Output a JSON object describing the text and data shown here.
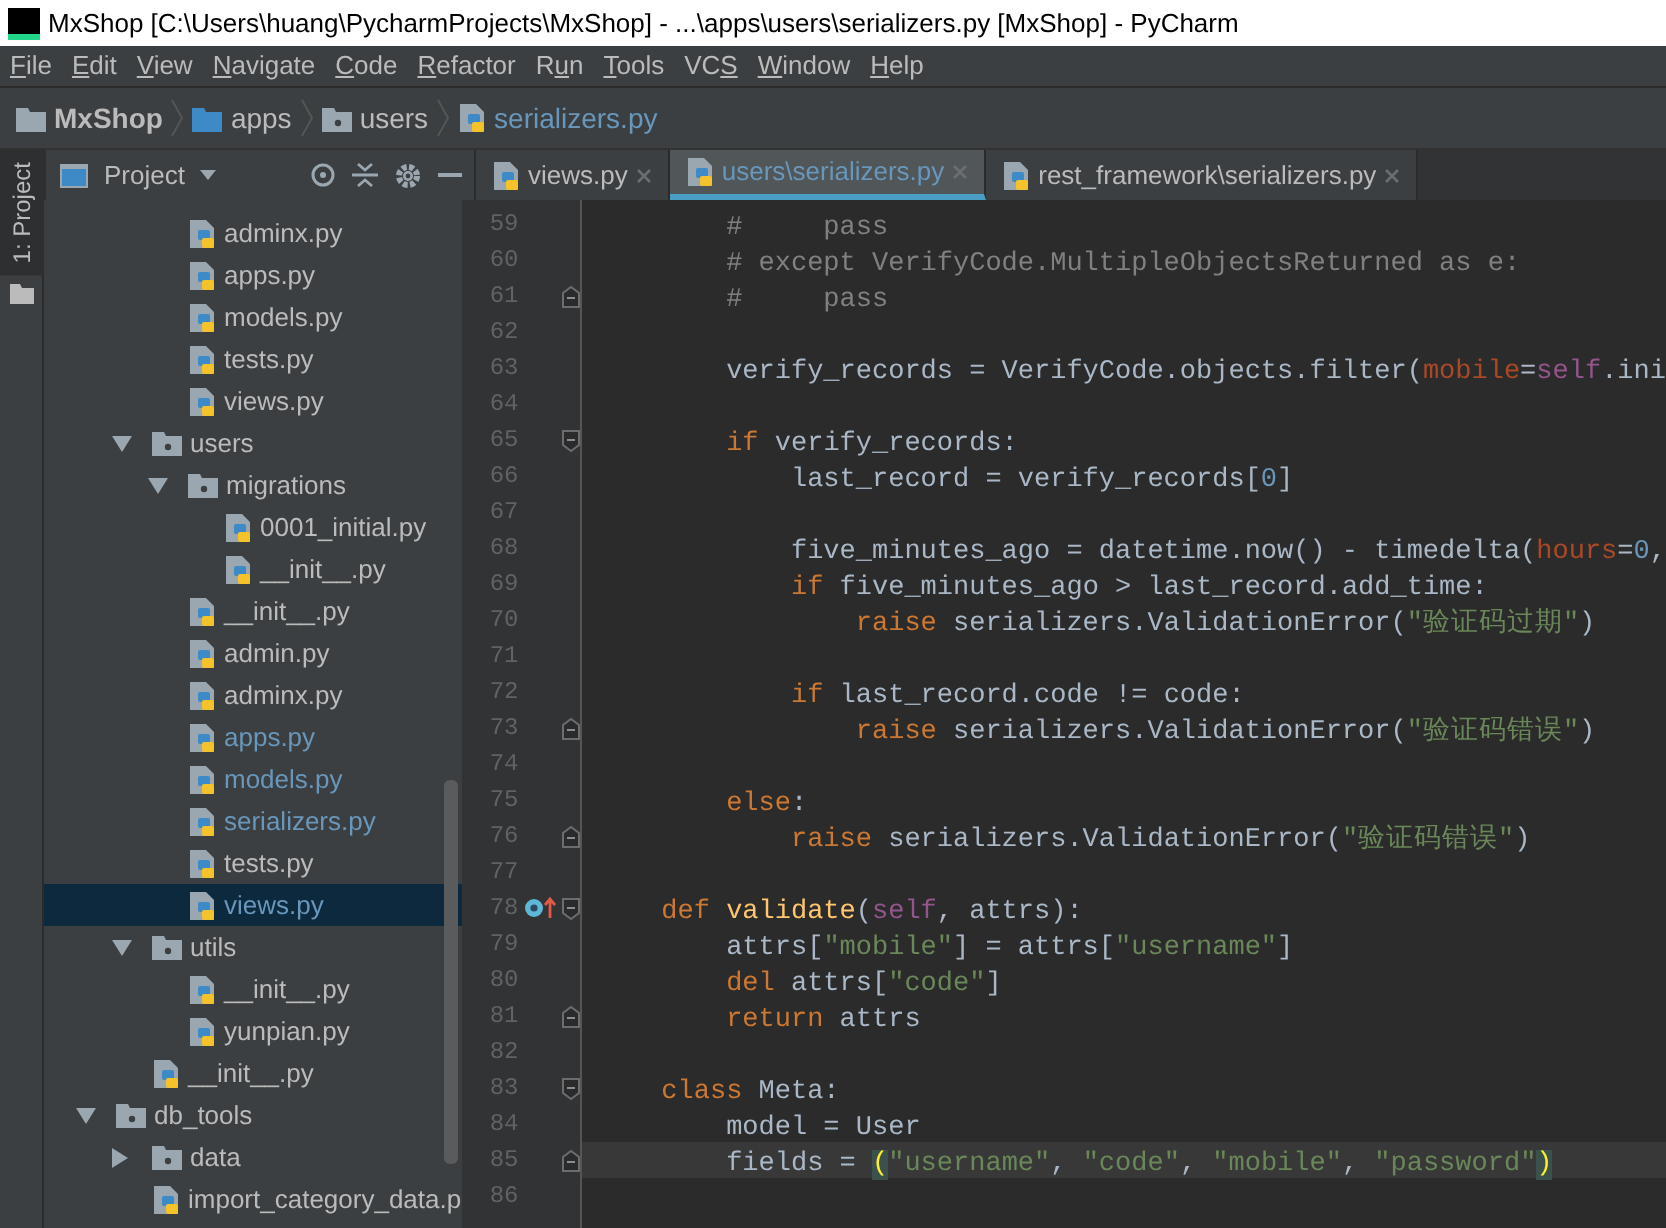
{
  "window": {
    "title": "MxShop [C:\\Users\\huang\\PycharmProjects\\MxShop] - ...\\apps\\users\\serializers.py [MxShop] - PyCharm"
  },
  "menu": [
    {
      "key": "F",
      "post": "ile"
    },
    {
      "key": "E",
      "post": "dit"
    },
    {
      "key": "V",
      "post": "iew"
    },
    {
      "key": "N",
      "post": "avigate"
    },
    {
      "key": "C",
      "post": "ode"
    },
    {
      "key": "R",
      "post": "efactor"
    },
    {
      "pre": "R",
      "key": "u",
      "post": "n"
    },
    {
      "key": "T",
      "post": "ools"
    },
    {
      "pre": "VC",
      "key": "S"
    },
    {
      "key": "W",
      "post": "indow"
    },
    {
      "key": "H",
      "post": "elp"
    }
  ],
  "breadcrumb": [
    {
      "label": "MxShop",
      "kind": "project"
    },
    {
      "label": "apps",
      "kind": "source-folder"
    },
    {
      "label": "users",
      "kind": "package"
    },
    {
      "label": "serializers.py",
      "kind": "file"
    }
  ],
  "side_stripe": {
    "label": "1: Project",
    "selected": true
  },
  "project_panel": {
    "title": "Project"
  },
  "tree": [
    {
      "kind": "continuation",
      "children": [
        {
          "kind": "continuation",
          "children": [
            {
              "kind": "file",
              "label": "adminx.py",
              "modified": false,
              "selected": false
            },
            {
              "kind": "file",
              "label": "apps.py",
              "modified": false,
              "selected": false
            },
            {
              "kind": "file",
              "label": "models.py",
              "modified": false,
              "selected": false
            },
            {
              "kind": "file",
              "label": "tests.py",
              "modified": false,
              "selected": false
            },
            {
              "kind": "file",
              "label": "views.py",
              "modified": false,
              "selected": false
            }
          ]
        },
        {
          "kind": "folder",
          "label": "users",
          "expanded": true,
          "children": [
            {
              "kind": "folder",
              "label": "migrations",
              "expanded": true,
              "children": [
                {
                  "kind": "file",
                  "label": "0001_initial.py",
                  "modified": false,
                  "selected": false
                },
                {
                  "kind": "file",
                  "label": "__init__.py",
                  "modified": false,
                  "selected": false
                }
              ]
            },
            {
              "kind": "file",
              "label": "__init__.py",
              "modified": false,
              "selected": false
            },
            {
              "kind": "file",
              "label": "admin.py",
              "modified": false,
              "selected": false
            },
            {
              "kind": "file",
              "label": "adminx.py",
              "modified": false,
              "selected": false
            },
            {
              "kind": "file",
              "label": "apps.py",
              "modified": true,
              "selected": false
            },
            {
              "kind": "file",
              "label": "models.py",
              "modified": true,
              "selected": false
            },
            {
              "kind": "file",
              "label": "serializers.py",
              "modified": true,
              "selected": false
            },
            {
              "kind": "file",
              "label": "tests.py",
              "modified": false,
              "selected": false
            },
            {
              "kind": "file",
              "label": "views.py",
              "modified": true,
              "selected": true
            }
          ]
        },
        {
          "kind": "folder",
          "label": "utils",
          "expanded": true,
          "children": [
            {
              "kind": "file",
              "label": "__init__.py",
              "modified": false,
              "selected": false
            },
            {
              "kind": "file",
              "label": "yunpian.py",
              "modified": false,
              "selected": false
            }
          ]
        },
        {
          "kind": "file",
          "label": "__init__.py",
          "modified": false,
          "selected": false
        }
      ]
    },
    {
      "kind": "folder",
      "label": "db_tools",
      "expanded": true,
      "children": [
        {
          "kind": "folder",
          "label": "data",
          "expanded": false
        },
        {
          "kind": "file",
          "label": "import_category_data.p",
          "modified": false,
          "selected": false
        }
      ]
    }
  ],
  "editor_tabs": [
    {
      "label": "views.py",
      "modified": false,
      "selected": false
    },
    {
      "label": "users\\serializers.py",
      "modified": true,
      "selected": true
    },
    {
      "label": "rest_framework\\serializers.py",
      "modified": false,
      "selected": false
    }
  ],
  "code_lines": [
    {
      "number": "59",
      "fold_start": false,
      "fold_end": false,
      "override": false,
      "current": false,
      "tokens": [
        {
          "kind": "comment",
          "text": "        #     pass"
        }
      ]
    },
    {
      "number": "60",
      "fold_start": false,
      "fold_end": false,
      "override": false,
      "current": false,
      "tokens": [
        {
          "kind": "comment",
          "text": "        # except VerifyCode.MultipleObjectsReturned as e:"
        }
      ]
    },
    {
      "number": "61",
      "fold_start": false,
      "fold_end": true,
      "override": false,
      "current": false,
      "tokens": [
        {
          "kind": "comment",
          "text": "        #     pass"
        }
      ]
    },
    {
      "number": "62",
      "fold_start": false,
      "fold_end": false,
      "override": false,
      "current": false
    },
    {
      "number": "63",
      "fold_start": false,
      "fold_end": false,
      "override": false,
      "current": false,
      "tokens": [
        {
          "kind": "plain",
          "text": "        verify_records = VerifyCode.objects.filter("
        },
        {
          "kind": "param",
          "text": "mobile"
        },
        {
          "kind": "plain",
          "text": "="
        },
        {
          "kind": "self",
          "text": "self"
        },
        {
          "kind": "plain",
          "text": ".ini"
        }
      ]
    },
    {
      "number": "64",
      "fold_start": false,
      "fold_end": false,
      "override": false,
      "current": false
    },
    {
      "number": "65",
      "fold_start": true,
      "fold_end": false,
      "override": false,
      "current": false,
      "tokens": [
        {
          "kind": "keyword",
          "text": "        if "
        },
        {
          "kind": "plain",
          "text": "verify_records:"
        }
      ]
    },
    {
      "number": "66",
      "fold_start": false,
      "fold_end": false,
      "override": false,
      "current": false,
      "tokens": [
        {
          "kind": "plain",
          "text": "            last_record = verify_records["
        },
        {
          "kind": "number",
          "text": "0"
        },
        {
          "kind": "plain",
          "text": "]"
        }
      ]
    },
    {
      "number": "67",
      "fold_start": false,
      "fold_end": false,
      "override": false,
      "current": false
    },
    {
      "number": "68",
      "fold_start": false,
      "fold_end": false,
      "override": false,
      "current": false,
      "tokens": [
        {
          "kind": "plain",
          "text": "            five_minutes_ago = datetime.now() - timedelta("
        },
        {
          "kind": "param",
          "text": "hours"
        },
        {
          "kind": "plain",
          "text": "="
        },
        {
          "kind": "number",
          "text": "0"
        },
        {
          "kind": "plain",
          "text": ","
        }
      ]
    },
    {
      "number": "69",
      "fold_start": false,
      "fold_end": false,
      "override": false,
      "current": false,
      "tokens": [
        {
          "kind": "keyword",
          "text": "            if "
        },
        {
          "kind": "plain",
          "text": "five_minutes_ago > last_record.add_time:"
        }
      ]
    },
    {
      "number": "70",
      "fold_start": false,
      "fold_end": false,
      "override": false,
      "current": false,
      "tokens": [
        {
          "kind": "keyword",
          "text": "                raise "
        },
        {
          "kind": "plain",
          "text": "serializers.ValidationError("
        },
        {
          "kind": "string",
          "text": "\"验证码过期\""
        },
        {
          "kind": "plain",
          "text": ")"
        }
      ]
    },
    {
      "number": "71",
      "fold_start": false,
      "fold_end": false,
      "override": false,
      "current": false
    },
    {
      "number": "72",
      "fold_start": false,
      "fold_end": false,
      "override": false,
      "current": false,
      "tokens": [
        {
          "kind": "keyword",
          "text": "            if "
        },
        {
          "kind": "plain",
          "text": "last_record.code != code:"
        }
      ]
    },
    {
      "number": "73",
      "fold_start": false,
      "fold_end": true,
      "override": false,
      "current": false,
      "tokens": [
        {
          "kind": "keyword",
          "text": "                raise "
        },
        {
          "kind": "plain",
          "text": "serializers.ValidationError("
        },
        {
          "kind": "string",
          "text": "\"验证码错误\""
        },
        {
          "kind": "plain",
          "text": ")"
        }
      ]
    },
    {
      "number": "74",
      "fold_start": false,
      "fold_end": false,
      "override": false,
      "current": false
    },
    {
      "number": "75",
      "fold_start": false,
      "fold_end": false,
      "override": false,
      "current": false,
      "tokens": [
        {
          "kind": "keyword",
          "text": "        else"
        },
        {
          "kind": "plain",
          "text": ":"
        }
      ]
    },
    {
      "number": "76",
      "fold_start": false,
      "fold_end": true,
      "override": false,
      "current": false,
      "tokens": [
        {
          "kind": "keyword",
          "text": "            raise "
        },
        {
          "kind": "plain",
          "text": "serializers.ValidationError("
        },
        {
          "kind": "string",
          "text": "\"验证码错误\""
        },
        {
          "kind": "plain",
          "text": ")"
        }
      ]
    },
    {
      "number": "77",
      "fold_start": false,
      "fold_end": false,
      "override": false,
      "current": false
    },
    {
      "number": "78",
      "fold_start": true,
      "fold_end": false,
      "override": true,
      "current": false,
      "tokens": [
        {
          "kind": "keyword",
          "text": "    def "
        },
        {
          "kind": "function",
          "text": "validate"
        },
        {
          "kind": "plain",
          "text": "("
        },
        {
          "kind": "self",
          "text": "self"
        },
        {
          "kind": "plain",
          "text": ", attrs):"
        }
      ]
    },
    {
      "number": "79",
      "fold_start": false,
      "fold_end": false,
      "override": false,
      "current": false,
      "tokens": [
        {
          "kind": "plain",
          "text": "        attrs["
        },
        {
          "kind": "string",
          "text": "\"mobile\""
        },
        {
          "kind": "plain",
          "text": "] = attrs["
        },
        {
          "kind": "string",
          "text": "\"username\""
        },
        {
          "kind": "plain",
          "text": "]"
        }
      ]
    },
    {
      "number": "80",
      "fold_start": false,
      "fold_end": false,
      "override": false,
      "current": false,
      "tokens": [
        {
          "kind": "keyword",
          "text": "        del "
        },
        {
          "kind": "plain",
          "text": "attrs["
        },
        {
          "kind": "string",
          "text": "\"code\""
        },
        {
          "kind": "plain",
          "text": "]"
        }
      ]
    },
    {
      "number": "81",
      "fold_start": false,
      "fold_end": true,
      "override": false,
      "current": false,
      "tokens": [
        {
          "kind": "keyword",
          "text": "        return "
        },
        {
          "kind": "plain",
          "text": "attrs"
        }
      ]
    },
    {
      "number": "82",
      "fold_start": false,
      "fold_end": false,
      "override": false,
      "current": false
    },
    {
      "number": "83",
      "fold_start": true,
      "fold_end": false,
      "override": false,
      "current": false,
      "tokens": [
        {
          "kind": "keyword",
          "text": "    class "
        },
        {
          "kind": "plain",
          "text": "Meta:"
        }
      ]
    },
    {
      "number": "84",
      "fold_start": false,
      "fold_end": false,
      "override": false,
      "current": false,
      "tokens": [
        {
          "kind": "plain",
          "text": "        model = User"
        }
      ]
    },
    {
      "number": "85",
      "fold_start": false,
      "fold_end": true,
      "override": false,
      "current": true,
      "tokens": [
        {
          "kind": "plain",
          "text": "        fields = "
        },
        {
          "kind": "brace",
          "text": "("
        },
        {
          "kind": "string",
          "text": "\"username\""
        },
        {
          "kind": "plain",
          "text": ", "
        },
        {
          "kind": "string",
          "text": "\"code\""
        },
        {
          "kind": "plain",
          "text": ", "
        },
        {
          "kind": "string",
          "text": "\"mobile\""
        },
        {
          "kind": "plain",
          "text": ", "
        },
        {
          "kind": "string",
          "text": "\"password\""
        },
        {
          "kind": "brace",
          "text": ")"
        }
      ]
    },
    {
      "number": "86",
      "fold_start": false,
      "fold_end": false,
      "override": false,
      "current": false
    }
  ]
}
